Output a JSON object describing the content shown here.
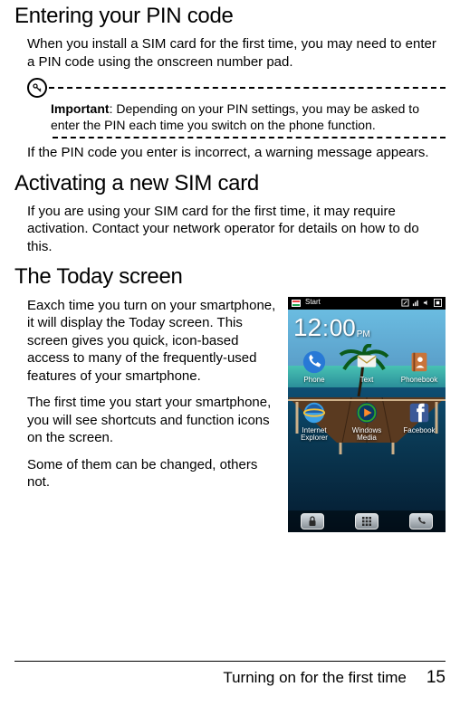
{
  "sections": {
    "pin": {
      "heading": "Entering your PIN code",
      "body": "When you install a SIM card for the first time, you may need to enter a PIN code using the onscreen number pad.",
      "important_label": "Important",
      "important_text": ": Depending on your PIN settings, you may be asked to enter the PIN each time you switch on the phone function.",
      "after_note": "If the PIN code you enter is incorrect, a warning message appears."
    },
    "activate": {
      "heading": "Activating a new SIM card",
      "body": "If you are using your SIM card for the first time, it may require activation. Contact your network operator for details on how to do this."
    },
    "today": {
      "heading": "The Today screen",
      "p1": "Eaxch time you turn on your smartphone, it will display the Today screen. This screen gives you quick, icon-based access to many of the frequently-used features of your smartphone.",
      "p2": "The first time you start your smartphone, you will see shortcuts and function icons on the screen.",
      "p3": "Some of them can be changed, others not."
    }
  },
  "phone": {
    "status_start": "Start",
    "clock_h": "12",
    "clock_sep": ":",
    "clock_m": "00",
    "clock_ampm": "PM",
    "apps_row1": [
      {
        "name": "phone-app",
        "label": "Phone"
      },
      {
        "name": "text-app",
        "label": "Text"
      },
      {
        "name": "phonebook-app",
        "label": "Phonebook"
      }
    ],
    "apps_row2": [
      {
        "name": "ie-app",
        "label1": "Internet",
        "label2": "Explorer"
      },
      {
        "name": "wmp-app",
        "label1": "Windows",
        "label2": "Media"
      },
      {
        "name": "facebook-app",
        "label1": "Facebook",
        "label2": ""
      }
    ]
  },
  "footer": {
    "chapter": "Turning on for the first time",
    "page": "15"
  }
}
